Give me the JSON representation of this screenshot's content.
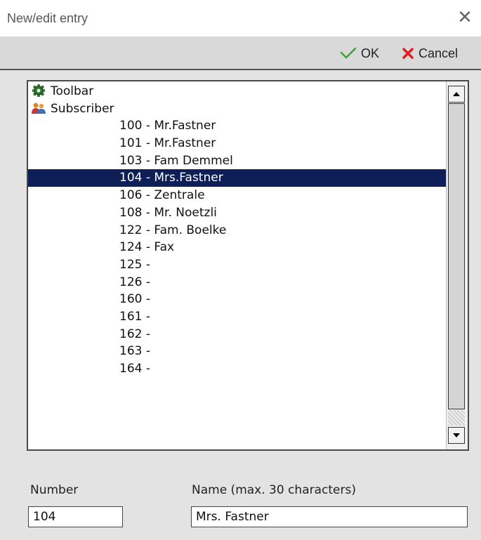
{
  "window": {
    "title": "New/edit entry",
    "close_glyph": "✕"
  },
  "toolbar": {
    "ok_label": "OK",
    "ok_icon": "check-icon",
    "ok_color": "#3aa23a",
    "cancel_label": "Cancel",
    "cancel_icon": "x-icon",
    "cancel_color": "#e02020"
  },
  "list": {
    "categories": [
      {
        "label": "Toolbar",
        "icon": "toolbar-gear-icon"
      },
      {
        "label": "Subscriber",
        "icon": "users-icon"
      }
    ],
    "items": [
      {
        "label": "100 - Mr.Fastner",
        "selected": false
      },
      {
        "label": "101 - Mr.Fastner",
        "selected": false
      },
      {
        "label": "103 - Fam Demmel",
        "selected": false
      },
      {
        "label": "104 - Mrs.Fastner",
        "selected": true
      },
      {
        "label": "106 - Zentrale",
        "selected": false
      },
      {
        "label": "108 - Mr. Noetzli",
        "selected": false
      },
      {
        "label": "122 - Fam. Boelke",
        "selected": false
      },
      {
        "label": "124 - Fax",
        "selected": false
      },
      {
        "label": "125 -",
        "selected": false
      },
      {
        "label": "126 -",
        "selected": false
      },
      {
        "label": "160 -",
        "selected": false
      },
      {
        "label": "161 -",
        "selected": false
      },
      {
        "label": "162 -",
        "selected": false
      },
      {
        "label": "163 -",
        "selected": false
      },
      {
        "label": "164 -",
        "selected": false
      }
    ],
    "selection_color": "#0d1f56"
  },
  "form": {
    "number_label": "Number",
    "number_value": "104",
    "name_label": "Name (max. 30 characters)",
    "name_value": "Mrs. Fastner"
  }
}
